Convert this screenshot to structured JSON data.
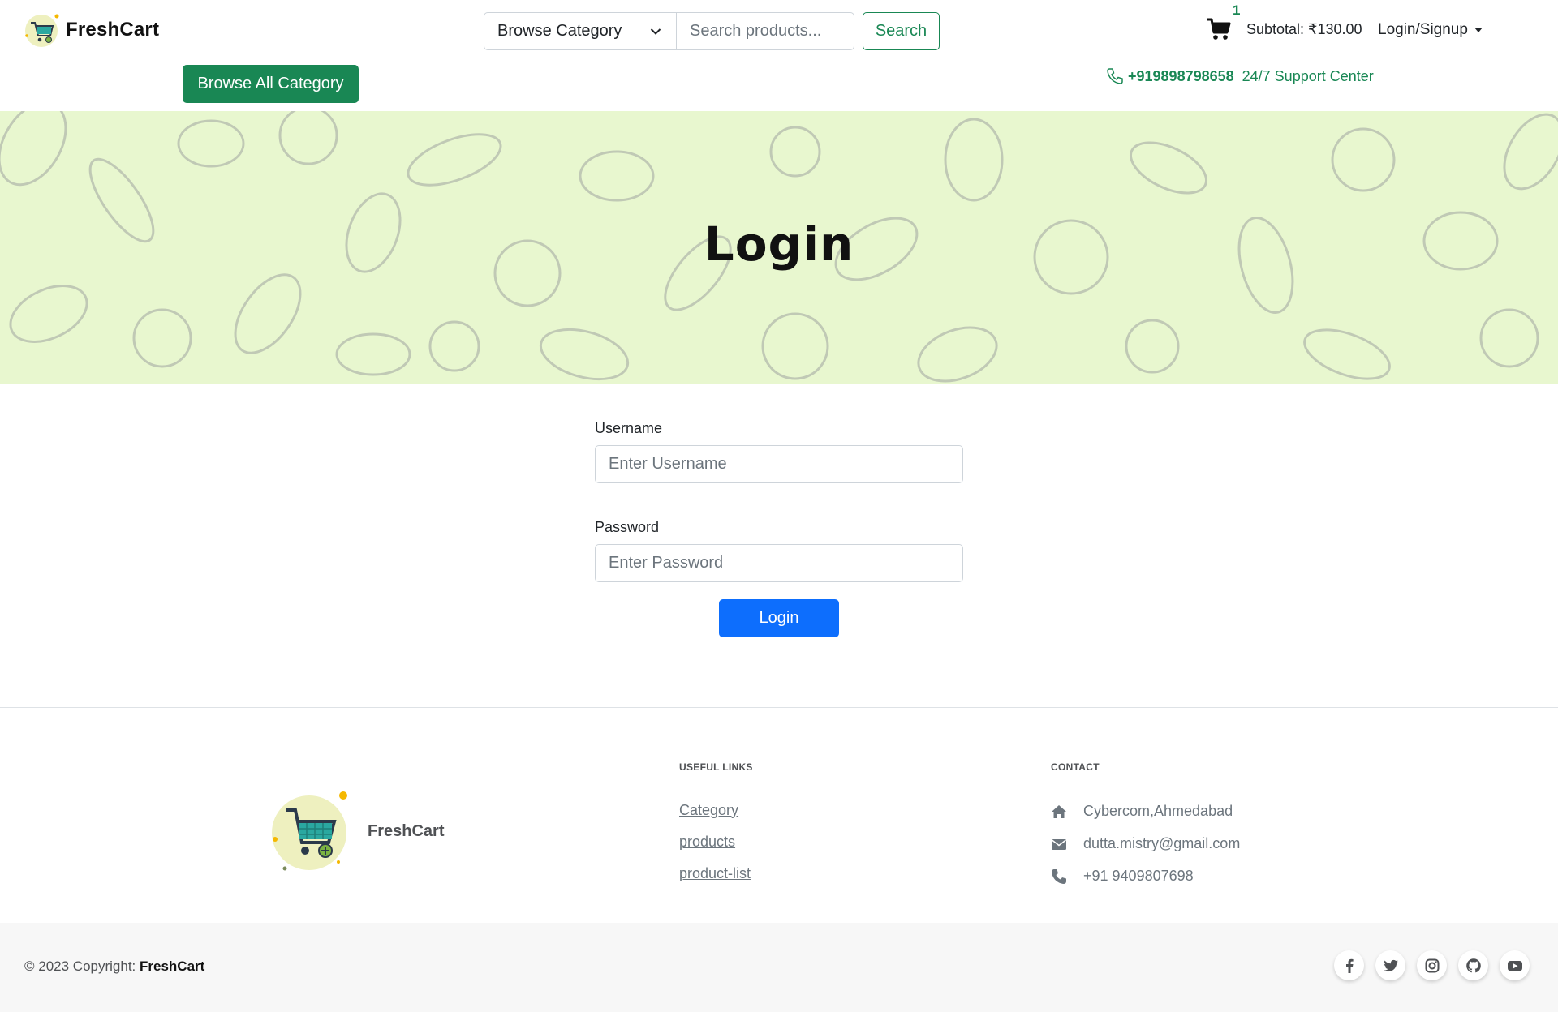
{
  "header": {
    "brand": "FreshCart",
    "browse_all_label": "Browse All Category",
    "category_select": "Browse Category",
    "search_placeholder": "Search products...",
    "search_label": "Search",
    "cart_count": "1",
    "subtotal": "Subtotal: ₹130.00",
    "account_menu": "Login/Signup",
    "support_phone": "+919898798658",
    "support_text": "24/7 Support Center"
  },
  "banner": {
    "title": "Login"
  },
  "login_form": {
    "username_label": "Username",
    "username_placeholder": "Enter Username",
    "password_label": "Password",
    "password_placeholder": "Enter Password",
    "submit_label": "Login"
  },
  "footer": {
    "brand": "FreshCart",
    "useful_links_title": "USEFUL LINKS",
    "useful_links": [
      "Category",
      "products",
      "product-list"
    ],
    "contact_title": "CONTACT",
    "contacts": [
      {
        "icon": "home-icon",
        "text": "Cybercom,Ahmedabad"
      },
      {
        "icon": "envelope-icon",
        "text": "dutta.mistry@gmail.com"
      },
      {
        "icon": "phone-icon",
        "text": "+91 9409807698"
      }
    ],
    "copyright_prefix": "© 2023 Copyright: ",
    "copyright_brand": "FreshCart",
    "socials": [
      "facebook-icon",
      "twitter-icon",
      "instagram-icon",
      "github-icon",
      "youtube-icon"
    ]
  },
  "colors": {
    "brand_green": "#198754",
    "primary_blue": "#0d6efd",
    "banner_bg": "#e8f7cf"
  }
}
